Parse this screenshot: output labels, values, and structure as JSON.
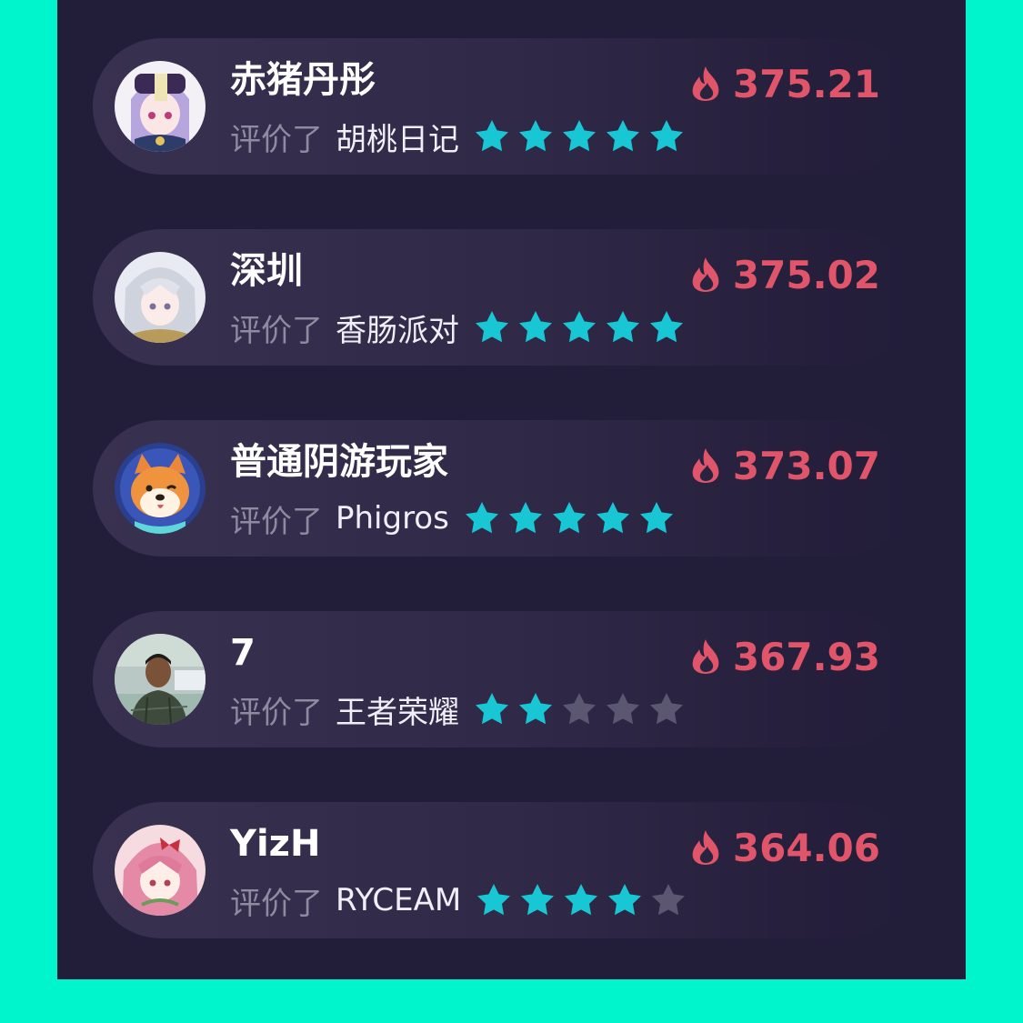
{
  "rated_label": "评价了",
  "accent_colors": {
    "background": "#00f5cc",
    "panel": "#221d39",
    "star_filled": "#18c6d4",
    "star_empty": "#5c5770",
    "score": "#e0556a"
  },
  "entries": [
    {
      "name": "赤猪丹彤",
      "game": "胡桃日记",
      "rating": 5,
      "max_rating": 5,
      "score": "375.21",
      "avatar_icon": "anime-girl-hat-avatar-icon"
    },
    {
      "name": "深圳",
      "game": "香肠派对",
      "rating": 5,
      "max_rating": 5,
      "score": "375.02",
      "avatar_icon": "anime-silver-hair-avatar-icon"
    },
    {
      "name": "普通阴游玩家",
      "game": "Phigros",
      "rating": 5,
      "max_rating": 5,
      "score": "373.07",
      "avatar_icon": "shiba-dog-avatar-icon"
    },
    {
      "name": "7",
      "game": "王者荣耀",
      "rating": 2,
      "max_rating": 5,
      "score": "367.93",
      "avatar_icon": "photo-person-avatar-icon"
    },
    {
      "name": "YizH",
      "game": "RYCEAM",
      "rating": 4,
      "max_rating": 5,
      "score": "364.06",
      "avatar_icon": "anime-pink-hair-avatar-icon"
    }
  ]
}
